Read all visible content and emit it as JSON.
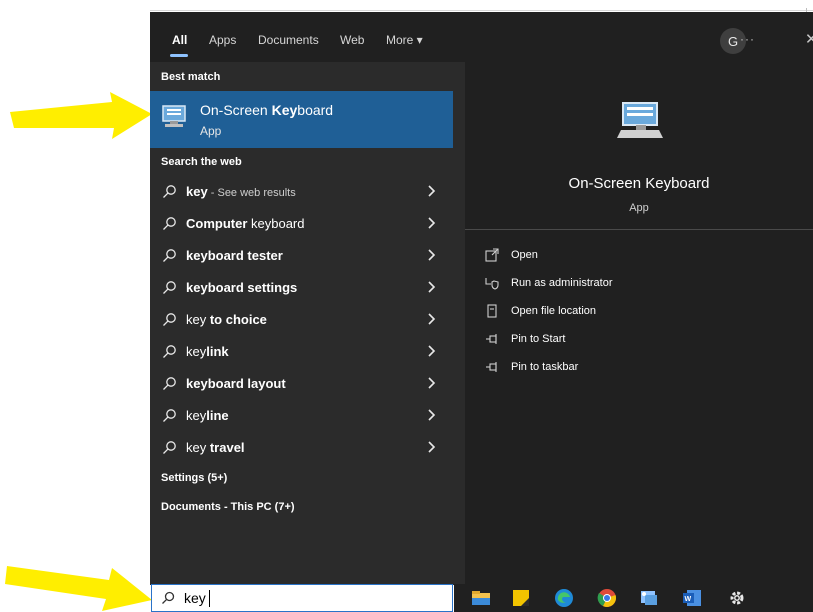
{
  "tabs": [
    {
      "label": "All",
      "active": true
    },
    {
      "label": "Apps"
    },
    {
      "label": "Documents"
    },
    {
      "label": "Web"
    },
    {
      "label": "More ▾"
    }
  ],
  "header": {
    "avatar_initial": "G",
    "more_glyph": "···",
    "close_glyph": "✕"
  },
  "sections": {
    "best_match": "Best match",
    "search_web": "Search the web",
    "settings": "Settings (5+)",
    "documents": "Documents - This PC (7+)"
  },
  "best_match": {
    "title_prefix": "On-Screen ",
    "title_bold": "Key",
    "title_suffix": "board",
    "subtitle": "App"
  },
  "web_results": [
    {
      "prefix": "",
      "bold": "key",
      "suffix": "",
      "hint": " - See web results"
    },
    {
      "prefix": "",
      "bold": "Computer",
      "suffix": " keyboard",
      "hint": ""
    },
    {
      "prefix": "",
      "bold": "keyboard tester",
      "suffix": "",
      "hint": ""
    },
    {
      "prefix": "",
      "bold": "keyboard settings",
      "suffix": "",
      "hint": ""
    },
    {
      "prefix": "key ",
      "bold": "to choice",
      "suffix": "",
      "hint": ""
    },
    {
      "prefix": "key",
      "bold": "link",
      "suffix": "",
      "hint": ""
    },
    {
      "prefix": "",
      "bold": "keyboard layout",
      "suffix": "",
      "hint": ""
    },
    {
      "prefix": "key",
      "bold": "line",
      "suffix": "",
      "hint": ""
    },
    {
      "prefix": "key ",
      "bold": "travel",
      "suffix": "",
      "hint": ""
    }
  ],
  "preview": {
    "title": "On-Screen Keyboard",
    "subtitle": "App",
    "actions": [
      {
        "label": "Open",
        "icon": "open-icon"
      },
      {
        "label": "Run as administrator",
        "icon": "shield-run-icon"
      },
      {
        "label": "Open file location",
        "icon": "folder-location-icon"
      },
      {
        "label": "Pin to Start",
        "icon": "pin-icon"
      },
      {
        "label": "Pin to taskbar",
        "icon": "pin-icon"
      }
    ]
  },
  "search": {
    "query": "key"
  },
  "taskbar": [
    "file-explorer-icon",
    "sticky-notes-icon",
    "edge-icon",
    "chrome-icon",
    "snipping-icon",
    "word-icon",
    "settings-gear-icon"
  ],
  "colors": {
    "accent": "#1f5f96",
    "arrow": "#ffee00",
    "panel_left": "#2b2b2b",
    "panel_right": "#202020"
  }
}
